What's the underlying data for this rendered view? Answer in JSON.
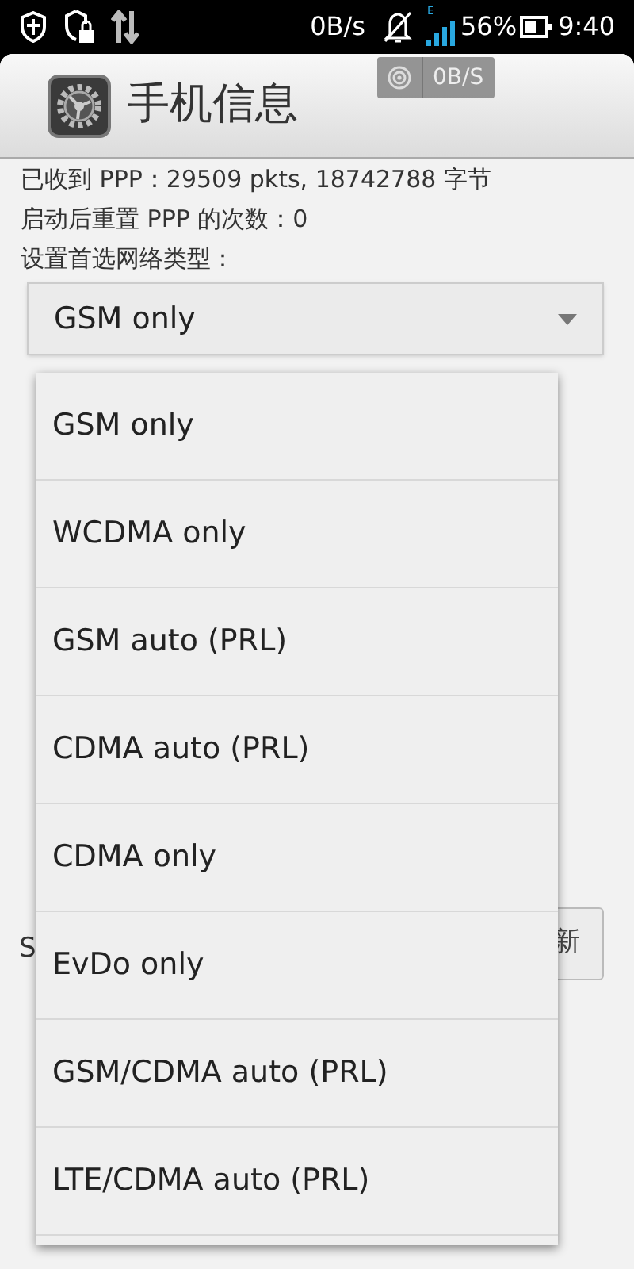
{
  "status_bar": {
    "speed": "0B/s",
    "network_type": "E",
    "battery": "56%",
    "time": "9:40"
  },
  "speed_badge": {
    "text": "0B/S"
  },
  "app_bar": {
    "title": "手机信息"
  },
  "info_lines": [
    "已收到 PPP：29509 pkts, 18742788 字节",
    "启动后重置 PPP 的次数：0"
  ],
  "network_type_label": "设置首选网络类型：",
  "network_spinner": {
    "value": "GSM only"
  },
  "hidden_label": "S",
  "hidden_button": "新",
  "dropdown": {
    "items": [
      {
        "label": "GSM only",
        "selected": false
      },
      {
        "label": "WCDMA only",
        "selected": false
      },
      {
        "label": "GSM auto (PRL)",
        "selected": false
      },
      {
        "label": "CDMA auto (PRL)",
        "selected": false
      },
      {
        "label": "CDMA only",
        "selected": false
      },
      {
        "label": "EvDo only",
        "selected": false
      },
      {
        "label": "GSM/CDMA auto (PRL)",
        "selected": false
      },
      {
        "label": "LTE/CDMA auto (PRL)",
        "selected": false
      }
    ]
  }
}
